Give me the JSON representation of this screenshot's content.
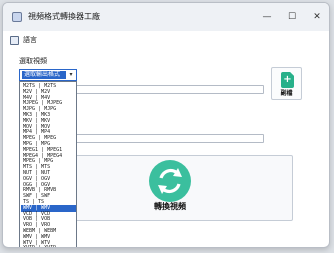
{
  "window": {
    "title": "視頻格式轉換器工廠",
    "controls": [
      "—",
      "☐",
      "✕"
    ]
  },
  "menu": {
    "items": [
      {
        "label": "語言",
        "icon": "language-icon"
      }
    ]
  },
  "main": {
    "select_label": "選取視頻",
    "format_select": {
      "value": "選取輸出格式"
    },
    "add_button": {
      "label": "副檔",
      "icon": "add-file-icon"
    },
    "convert_button": {
      "label": "轉換視頻",
      "icon": "refresh-icon"
    }
  },
  "dropdown": {
    "selected_index": 21,
    "items": [
      "M2TS | M2TS",
      "M2V | M2V",
      "M4V | M4V",
      "MJPEG | MJPEG",
      "MJPG | MJPG",
      "MK3 | MK3",
      "MKV | MKV",
      "MOV | MOV",
      "MP4 | MP4",
      "MPEG | MPEG",
      "MPG | MPG",
      "MPEG1 | MPEG1",
      "MPEG4 | MPEG4",
      "MPEG | MPG",
      "MTS | MTS",
      "NUT | NUT",
      "OGV | OGV",
      "OGG | OGV",
      "RMVB | RMVB",
      "SWF | SWF",
      "TS | TS",
      "WMV | WMV",
      "VCD | VCD",
      "VOB | VOB",
      "VRO | VRO",
      "WEBM | WEBM",
      "WMV | WMV",
      "WTV | WTV",
      "XVID | XVID"
    ]
  }
}
